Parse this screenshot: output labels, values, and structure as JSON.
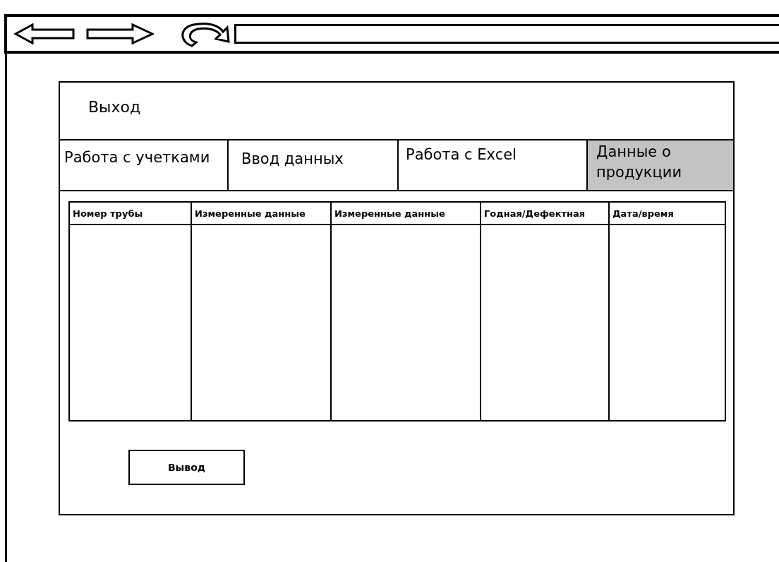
{
  "header": {
    "exit_label": "Выход"
  },
  "tabs": [
    {
      "label": "Работа с учетками",
      "selected": false
    },
    {
      "label": "Ввод данных",
      "selected": false
    },
    {
      "label": "Работа с Excel",
      "selected": false
    },
    {
      "label": "Данные о продукции",
      "selected": true
    }
  ],
  "table": {
    "columns": [
      "Номер трубы",
      "Измеренные данные",
      "Измеренные данные",
      "Годная/Дефектная",
      "Дата/время"
    ]
  },
  "buttons": [
    "Вывод"
  ]
}
